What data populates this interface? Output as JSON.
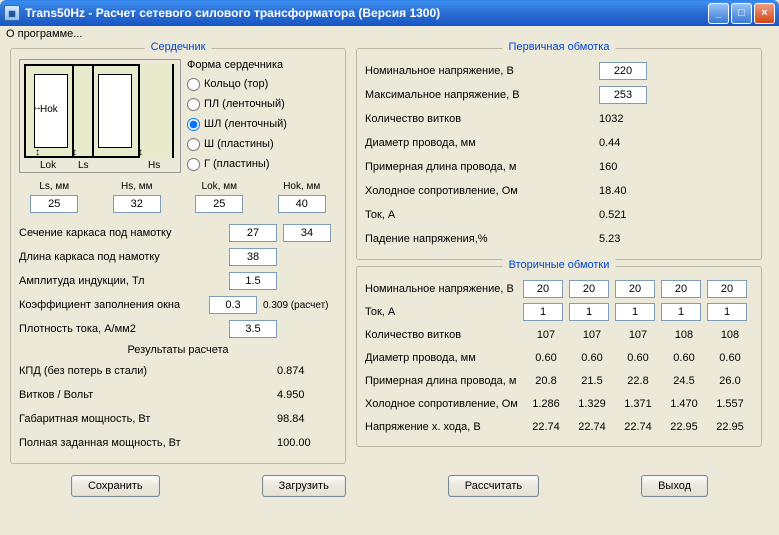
{
  "title": "Trans50Hz - Расчет сетевого силового трансформатора (Версия 1300)",
  "menu": {
    "about": "О программе..."
  },
  "groups": {
    "core": "Сердечник",
    "primary": "Первичная обмотка",
    "secondary": "Вторичные обмотки"
  },
  "core": {
    "shape_label": "Форма сердечника",
    "options": {
      "ring": "Кольцо (тор)",
      "pl": "ПЛ (ленточный)",
      "shl": "ШЛ (ленточный)",
      "sh": "Ш (пластины)",
      "g": "Г (пластины)"
    },
    "selected": "shl",
    "diagram": {
      "hok": "Hok",
      "lok": "Lok",
      "ls": "Ls",
      "hs": "Hs"
    },
    "dims": {
      "ls": {
        "label": "Ls, мм",
        "value": "25"
      },
      "hs": {
        "label": "Hs, мм",
        "value": "32"
      },
      "lok": {
        "label": "Lok, мм",
        "value": "25"
      },
      "hok": {
        "label": "Hok, мм",
        "value": "40"
      }
    },
    "params": {
      "frame_section": {
        "label": "Сечение каркаса под намотку",
        "v1": "27",
        "v2": "34"
      },
      "frame_length": {
        "label": "Длина каркаса под намотку",
        "v1": "38"
      },
      "induction": {
        "label": "Амплитуда индукции, Тл",
        "v1": "1.5"
      },
      "fill_factor": {
        "label": "Коэффициент заполнения окна",
        "v1": "0.3",
        "calc": "0.309 (расчет)"
      },
      "current_density": {
        "label": "Плотность тока, А/мм2",
        "v1": "3.5"
      }
    },
    "results_heading": "Результаты расчета",
    "results": {
      "kpd": {
        "label": "КПД (без потерь в стали)",
        "value": "0.874"
      },
      "turns_volt": {
        "label": "Витков / Вольт",
        "value": "4.950"
      },
      "power": {
        "label": "Габаритная мощность, Вт",
        "value": "98.84"
      },
      "full_power": {
        "label": "Полная заданная мощность, Вт",
        "value": "100.00"
      }
    }
  },
  "primary": {
    "nominal_v": {
      "label": "Номинальное напряжение, В",
      "value": "220"
    },
    "max_v": {
      "label": "Максимальное напряжение, В",
      "value": "253"
    },
    "turns": {
      "label": "Количество витков",
      "value": "1032"
    },
    "wire_d": {
      "label": "Диаметр провода, мм",
      "value": "0.44"
    },
    "wire_len": {
      "label": "Примерная длина провода, м",
      "value": "160"
    },
    "cold_r": {
      "label": "Холодное сопротивление, Ом",
      "value": "18.40"
    },
    "current": {
      "label": "Ток, А",
      "value": "0.521"
    },
    "vdrop": {
      "label": "Падение напряжения,%",
      "value": "5.23"
    }
  },
  "secondary": {
    "rows": {
      "nominal_v": {
        "label": "Номинальное напряжение, В",
        "vals": [
          "20",
          "20",
          "20",
          "20",
          "20"
        ],
        "input": true
      },
      "current": {
        "label": "Ток, А",
        "vals": [
          "1",
          "1",
          "1",
          "1",
          "1"
        ],
        "input": true
      },
      "turns": {
        "label": "Количество витков",
        "vals": [
          "107",
          "107",
          "107",
          "108",
          "108"
        ]
      },
      "wire_d": {
        "label": "Диаметр провода, мм",
        "vals": [
          "0.60",
          "0.60",
          "0.60",
          "0.60",
          "0.60"
        ]
      },
      "wire_len": {
        "label": "Примерная длина провода, м",
        "vals": [
          "20.8",
          "21.5",
          "22.8",
          "24.5",
          "26.0"
        ]
      },
      "cold_r": {
        "label": "Холодное сопротивление, Ом",
        "vals": [
          "1.286",
          "1.329",
          "1.371",
          "1.470",
          "1.557"
        ]
      },
      "idle_v": {
        "label": "Напряжение х. хода, В",
        "vals": [
          "22.74",
          "22.74",
          "22.74",
          "22.95",
          "22.95"
        ]
      }
    }
  },
  "buttons": {
    "save": "Сохранить",
    "load": "Загрузить",
    "calc": "Рассчитать",
    "exit": "Выход"
  }
}
